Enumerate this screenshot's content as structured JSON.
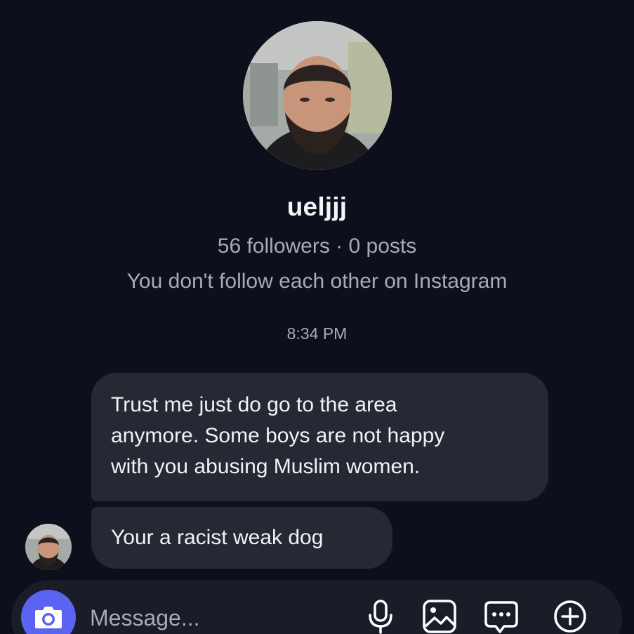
{
  "profile": {
    "username": "ueljjj",
    "stats": "56 followers · 0 posts",
    "follow_note": "You don't follow each other on Instagram"
  },
  "thread": {
    "timestamp": "8:34 PM",
    "messages": [
      {
        "lines": [
          "Trust me just do go to the area",
          "anymore. Some boys are not happy",
          "with you abusing Muslim women."
        ]
      },
      {
        "text": "Your a racist weak dog"
      }
    ]
  },
  "composer": {
    "placeholder": "Message...",
    "icons": [
      "camera-icon",
      "microphone-icon",
      "gallery-icon",
      "sticker-icon",
      "plus-icon"
    ]
  },
  "colors": {
    "background": "#0d0f1d",
    "bubble": "#262833",
    "accent": "#5a63f2",
    "muted_text": "#a8abb6"
  }
}
